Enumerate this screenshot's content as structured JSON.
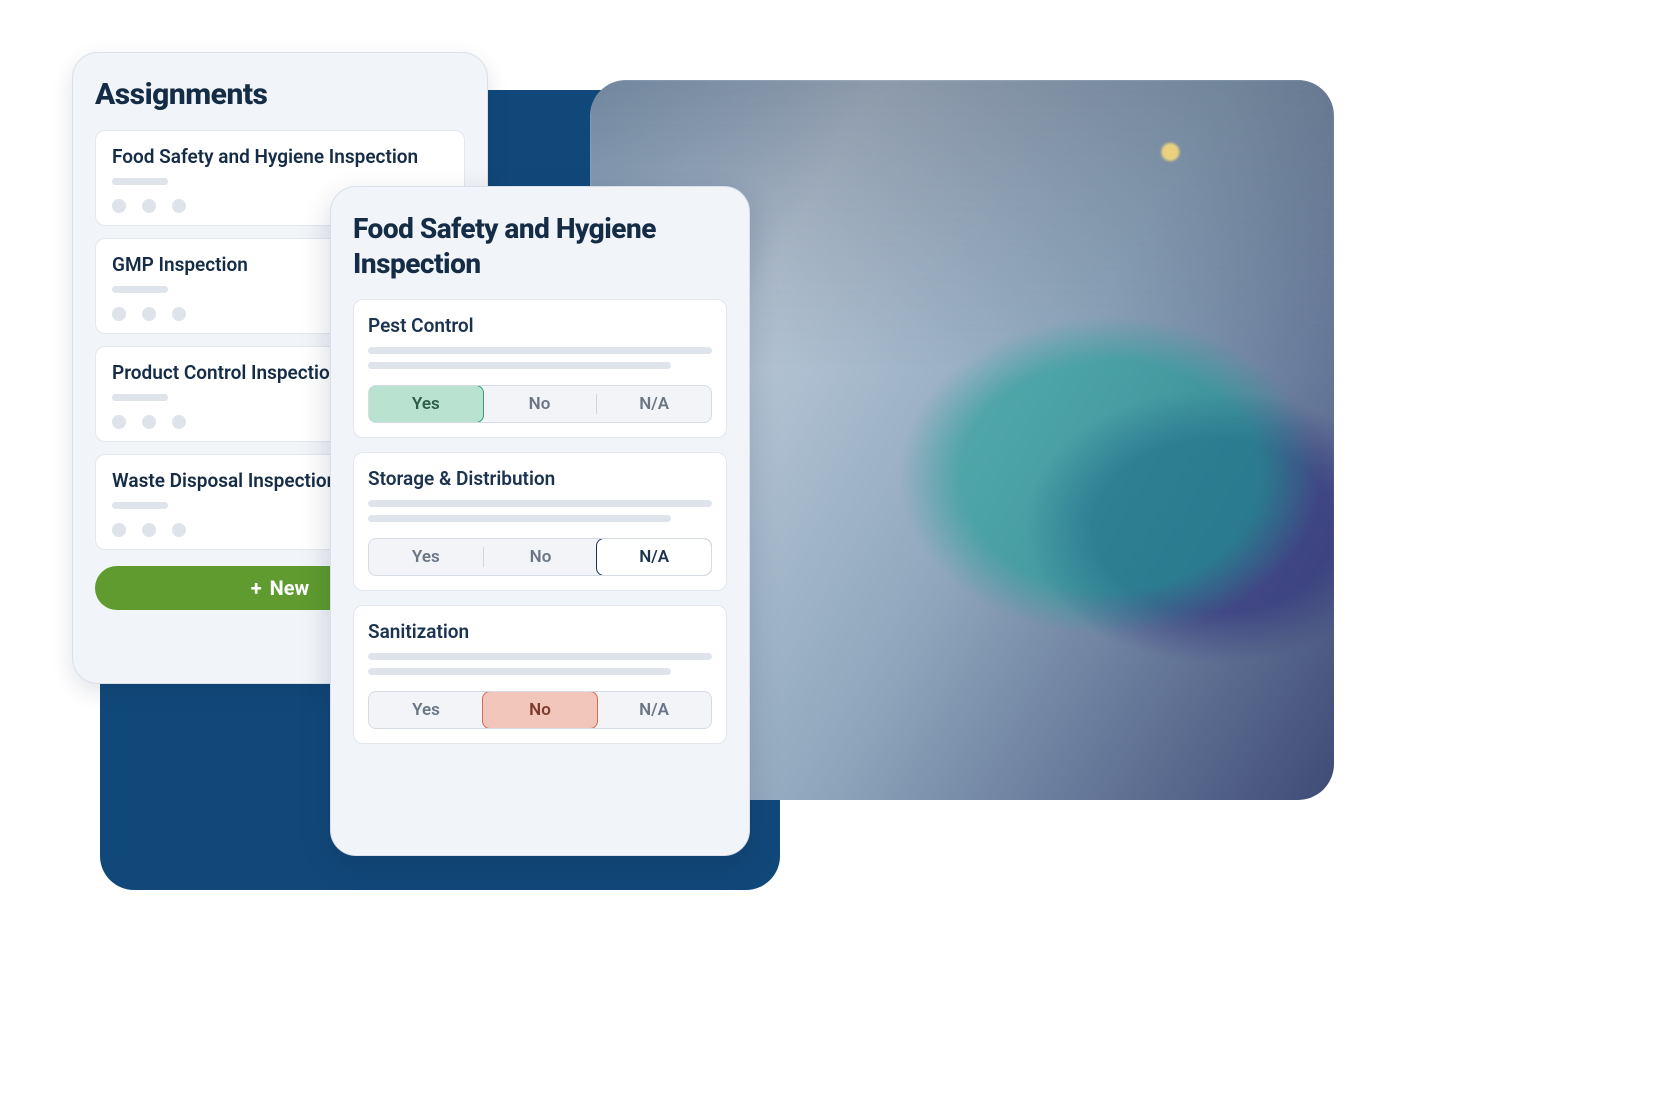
{
  "assignments": {
    "title": "Assignments",
    "items": [
      {
        "title": "Food Safety and Hygiene Inspection"
      },
      {
        "title": "GMP Inspection"
      },
      {
        "title": "Product Control Inspection"
      },
      {
        "title": "Waste Disposal Inspection"
      }
    ],
    "new_label": "New"
  },
  "inspection": {
    "title": "Food Safety and Hygiene Inspection",
    "questions": [
      {
        "title": "Pest Control",
        "options": [
          "Yes",
          "No",
          "N/A"
        ],
        "selected": "Yes"
      },
      {
        "title": "Storage & Distribution",
        "options": [
          "Yes",
          "No",
          "N/A"
        ],
        "selected": "N/A"
      },
      {
        "title": "Sanitization",
        "options": [
          "Yes",
          "No",
          "N/A"
        ],
        "selected": "No"
      }
    ]
  }
}
